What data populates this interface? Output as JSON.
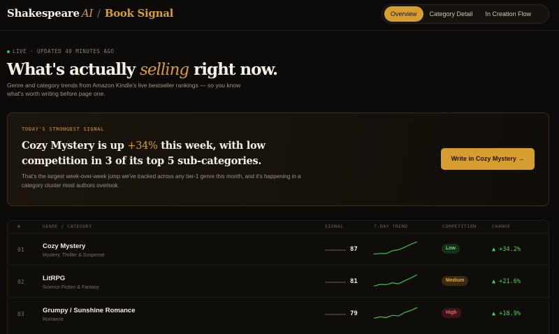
{
  "brand": {
    "part1": "Shakespeare",
    "part2": "AI",
    "separator": "/",
    "part3": "Book Signal"
  },
  "tabs": [
    {
      "label": "Overview",
      "active": true
    },
    {
      "label": "Category Detail",
      "active": false
    },
    {
      "label": "In Creation Flow",
      "active": false
    }
  ],
  "status": {
    "text": "LIVE · UPDATED 40 MINUTES AGO",
    "color": "#3fbf4f"
  },
  "hero": {
    "title_before": "What's actually ",
    "title_em": "selling",
    "title_after": " right now.",
    "subtitle": "Genre and category trends from Amazon Kindle's live bestseller rankings — so you know what's worth writing before page one."
  },
  "signal_card": {
    "label": "TODAY'S STRONGEST SIGNAL",
    "headline_before": "Cozy Mystery is up ",
    "headline_highlight": "+34%",
    "headline_after": " this week, with low competition in 3 of its top 5 sub-categories.",
    "body": "That's the largest week-over-week jump we've tracked across any tier-1 genre this month, and it's happening in a category cluster most authors overlook.",
    "cta": "Write in Cozy Mystery →"
  },
  "table": {
    "headers": {
      "rank": "#",
      "genre": "GENRE / CATEGORY",
      "signal": "SIGNAL",
      "trend": "7-DAY TREND",
      "competition": "COMPETITION",
      "change": "CHANGE"
    },
    "rows": [
      {
        "rank": "01",
        "name": "Cozy Mystery",
        "sub": "Mystery, Thriller & Suspense",
        "signal": 87,
        "signal_text": "87",
        "competition": "Low",
        "level": "low",
        "change": "▲ +34.2%",
        "trend": [
          2,
          2.4,
          2.3,
          4.2,
          4.8,
          6.5,
          8.4,
          10
        ]
      },
      {
        "rank": "02",
        "name": "LitRPG",
        "sub": "Science Fiction & Fantasy",
        "signal": 81,
        "signal_text": "81",
        "competition": "Medium",
        "level": "med",
        "change": "▲ +21.6%",
        "trend": [
          2,
          3.2,
          3.0,
          4.2,
          3.6,
          5.6,
          7.4,
          9.5
        ]
      },
      {
        "rank": "03",
        "name": "Grumpy / Sunshine Romance",
        "sub": "Romance",
        "signal": 79,
        "signal_text": "79",
        "competition": "High",
        "level": "high",
        "change": "▲ +18.9%",
        "trend": [
          2,
          3.0,
          2.5,
          4.0,
          3.6,
          5.8,
          7.2,
          9
        ]
      }
    ]
  },
  "colors": {
    "accent": "#d69e2e",
    "positive": "#4fcf5f",
    "trend_line": "#35c44a"
  }
}
